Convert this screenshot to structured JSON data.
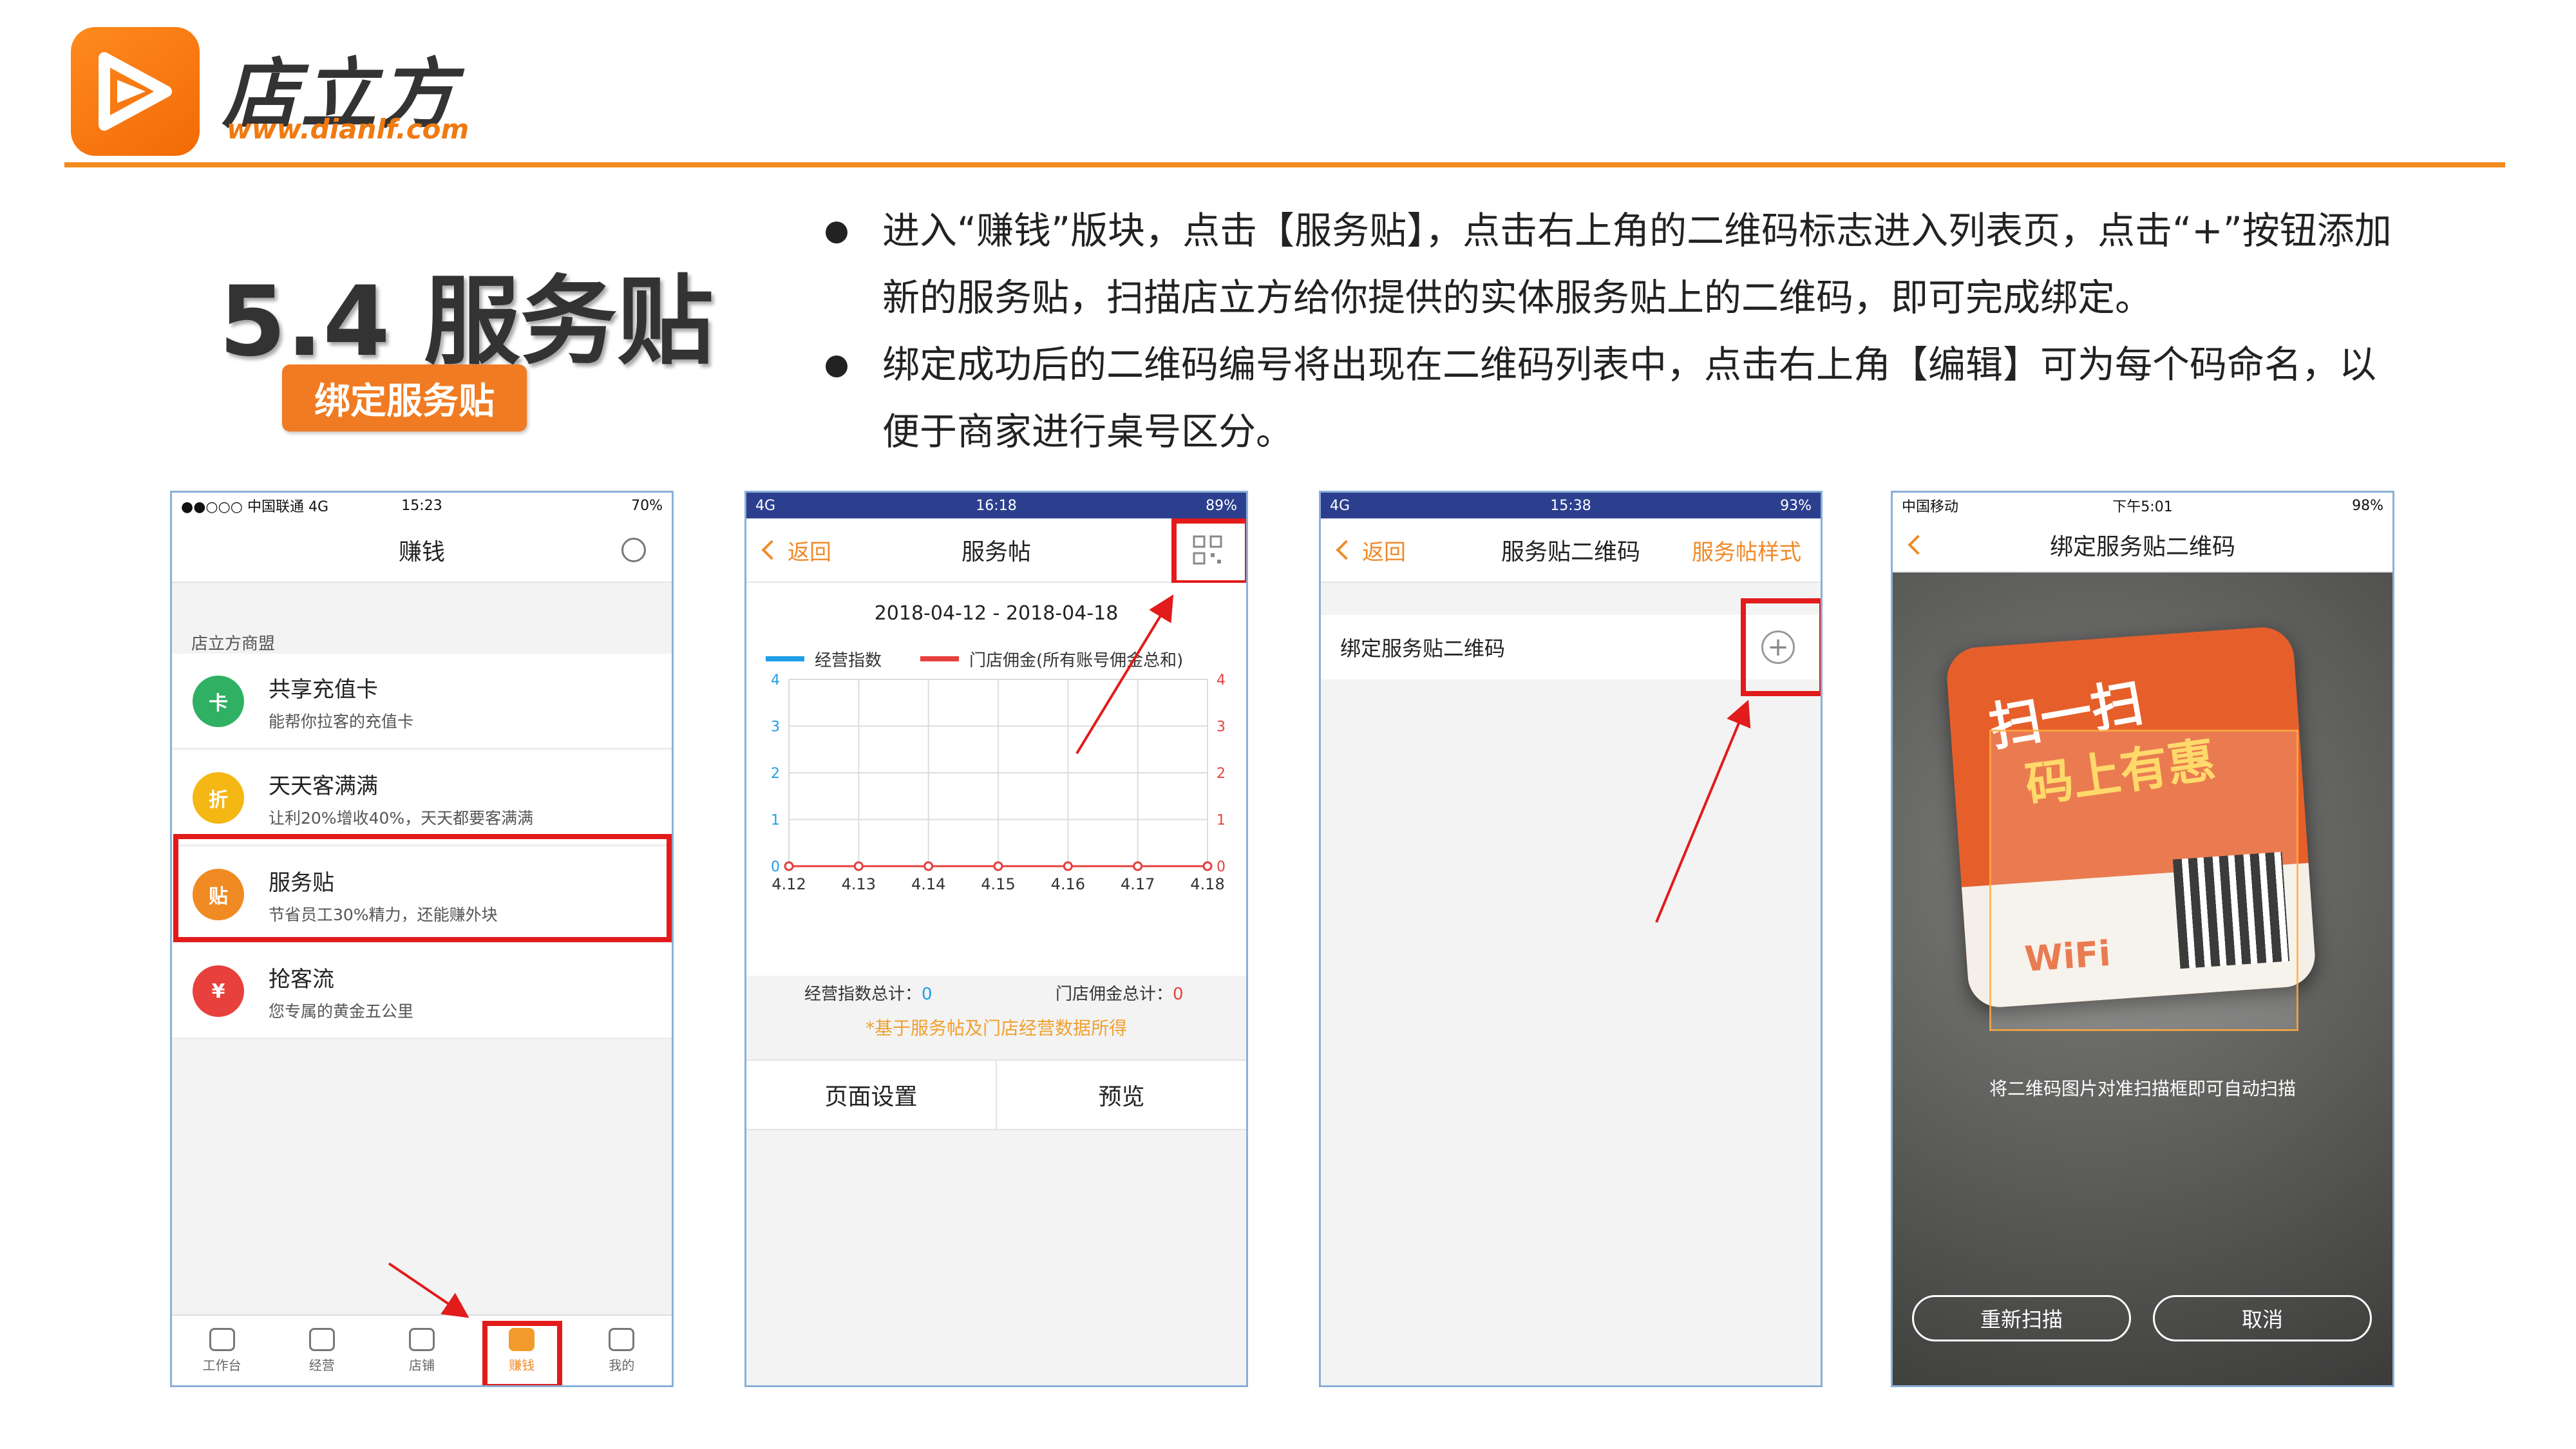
{
  "brand": {
    "name": "店立方",
    "url": "www.dianlf.com"
  },
  "section": {
    "title": "5.4 服务贴",
    "tag": "绑定服务贴"
  },
  "bullets": [
    "进入“赚钱”版块，点击【服务贴】，点击右上角的二维码标志进入列表页，点击“+”按钮添加新的服务贴，扫描店立方给你提供的实体服务贴上的二维码，即可完成绑定。",
    "绑定成功后的二维码编号将出现在二维码列表中，点击右上角【编辑】可为每个码命名，以便于商家进行桌号区分。"
  ],
  "phone1": {
    "status": {
      "left": "●●○○○ 中国联通  4G",
      "time": "15:23",
      "right": "70%"
    },
    "title": "赚钱",
    "section_label": "店立方商盟",
    "items": [
      {
        "title": "共享充值卡",
        "sub": "能帮你拉客的充值卡",
        "color": "#2fb062",
        "icon": "card-icon",
        "glyph": "卡"
      },
      {
        "title": "天天客满满",
        "sub": "让利20%增收40%，天天都要客满满",
        "color": "#f5b714",
        "icon": "discount-icon",
        "glyph": "折"
      },
      {
        "title": "服务贴",
        "sub": "节省员工30%精力，还能赚外块",
        "color": "#f08a22",
        "icon": "sticker-icon",
        "glyph": "贴"
      },
      {
        "title": "抢客流",
        "sub": "您专属的黄金五公里",
        "color": "#e8403c",
        "icon": "ticket-icon",
        "glyph": "¥"
      }
    ],
    "tabs": [
      "工作台",
      "经营",
      "店铺",
      "赚钱",
      "我的"
    ]
  },
  "phone2": {
    "status": {
      "left": "4G",
      "time": "16:18",
      "right": "89%"
    },
    "back": "返回",
    "title": "服务帖",
    "date_range": "2018-04-12 - 2018-04-18",
    "legend": [
      {
        "label": "经营指数",
        "color": "#1f9de8"
      },
      {
        "label": "门店佣金(所有账号佣金总和)",
        "color": "#e8403c"
      }
    ],
    "totals": {
      "index_label": "经营指数总计：",
      "index_value": "0",
      "commission_label": "门店佣金总计：",
      "commission_value": "0"
    },
    "note": "*基于服务帖及门店经营数据所得",
    "footer": [
      "页面设置",
      "预览"
    ]
  },
  "chart_data": {
    "type": "line",
    "categories": [
      "4.12",
      "4.13",
      "4.14",
      "4.15",
      "4.16",
      "4.17",
      "4.18"
    ],
    "series": [
      {
        "name": "经营指数",
        "values": [
          0,
          0,
          0,
          0,
          0,
          0,
          0
        ],
        "color": "#1f9de8"
      },
      {
        "name": "门店佣金(所有账号佣金总和)",
        "values": [
          0,
          0,
          0,
          0,
          0,
          0,
          0
        ],
        "color": "#e8403c"
      }
    ],
    "ylim": [
      0,
      4
    ],
    "yticks": [
      0,
      1,
      2,
      3,
      4
    ],
    "grid": true
  },
  "phone3": {
    "status": {
      "left": "4G",
      "time": "15:38",
      "right": "93%"
    },
    "back": "返回",
    "title": "服务贴二维码",
    "right_action": "服务帖样式",
    "row_label": "绑定服务贴二维码",
    "plus": "+"
  },
  "phone4": {
    "status": {
      "left": "中国移动",
      "time": "下午5:01",
      "right": "98%"
    },
    "title": "绑定服务贴二维码",
    "card_line1": "扫一扫",
    "card_line2": "码上有惠",
    "card_wifi": "WiFi",
    "hint": "将二维码图片对准扫描框即可自动扫描",
    "rescan": "重新扫描",
    "cancel": "取消"
  }
}
